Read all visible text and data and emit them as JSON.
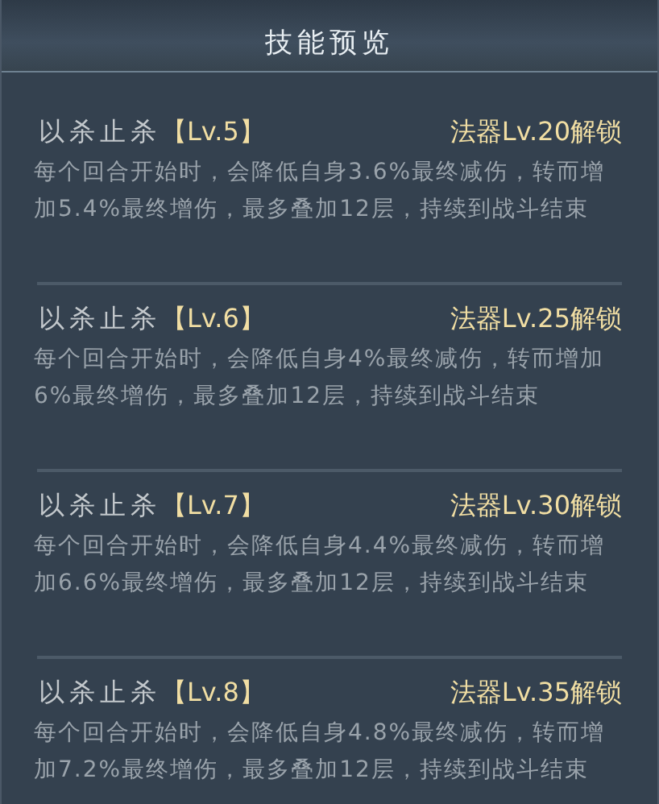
{
  "title": "技能预览",
  "skills": [
    {
      "name": "以杀止杀",
      "level": "【Lv.5】",
      "unlock": "法器Lv.20解锁",
      "description": "每个回合开始时，会降低自身3.6%最终减伤，转而增加5.4%最终增伤，最多叠加12层，持续到战斗结束"
    },
    {
      "name": "以杀止杀",
      "level": "【Lv.6】",
      "unlock": "法器Lv.25解锁",
      "description": "每个回合开始时，会降低自身4%最终减伤，转而增加6%最终增伤，最多叠加12层，持续到战斗结束"
    },
    {
      "name": "以杀止杀",
      "level": "【Lv.7】",
      "unlock": "法器Lv.30解锁",
      "description": "每个回合开始时，会降低自身4.4%最终减伤，转而增加6.6%最终增伤，最多叠加12层，持续到战斗结束"
    },
    {
      "name": "以杀止杀",
      "level": "【Lv.8】",
      "unlock": "法器Lv.35解锁",
      "description": "每个回合开始时，会降低自身4.8%最终减伤，转而增加7.2%最终增伤，最多叠加12层，持续到战斗结束"
    }
  ]
}
